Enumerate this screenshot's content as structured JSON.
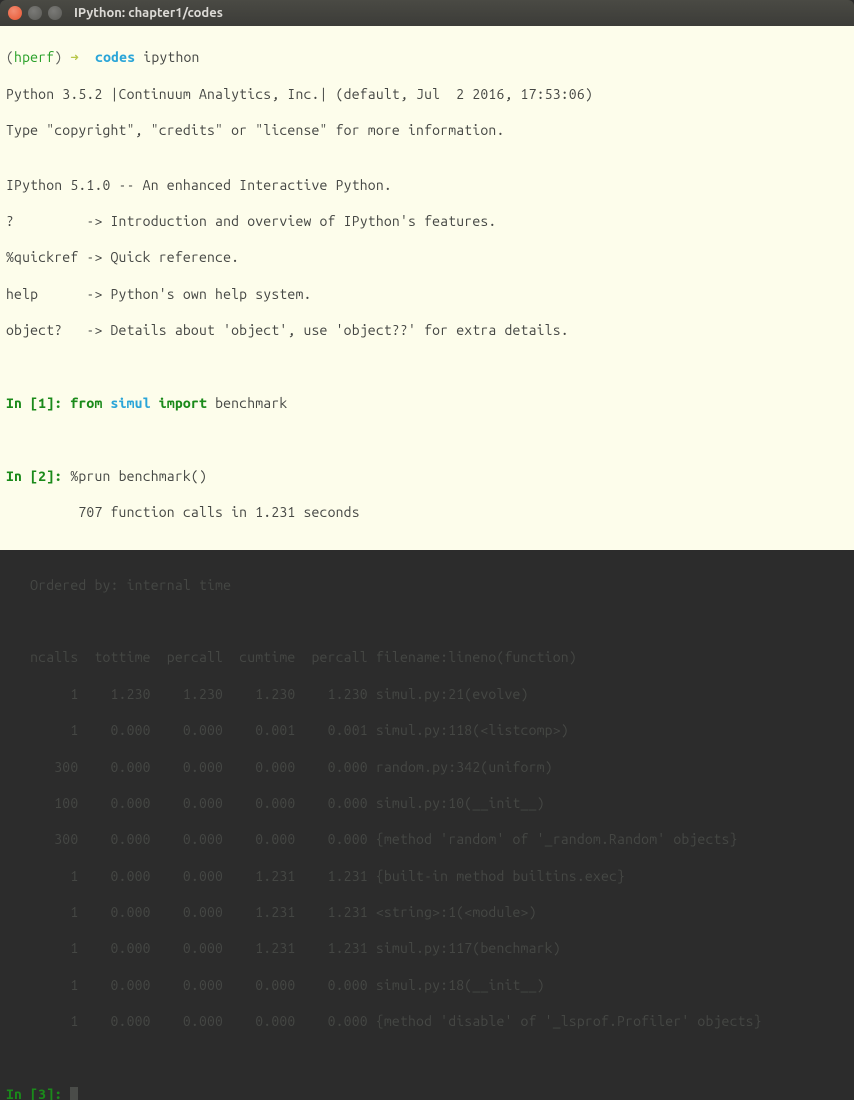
{
  "window": {
    "title": "IPython: chapter1/codes"
  },
  "prompt": {
    "venv_open": "(",
    "venv": "hperf",
    "venv_close": ")",
    "arrow": " ➜ ",
    "dir": " codes",
    "cmd": " ipython"
  },
  "banner": {
    "l1": "Python 3.5.2 |Continuum Analytics, Inc.| (default, Jul  2 2016, 17:53:06)",
    "l2": "Type \"copyright\", \"credits\" or \"license\" for more information.",
    "l3": "",
    "l4": "IPython 5.1.0 -- An enhanced Interactive Python.",
    "l5": "?         -> Introduction and overview of IPython's features.",
    "l6": "%quickref -> Quick reference.",
    "l7": "help      -> Python's own help system.",
    "l8": "object?   -> Details about 'object', use 'object??' for extra details."
  },
  "in1": {
    "label": "In [1]: ",
    "kw_from": "from ",
    "mod": "simul",
    "kw_import": " import ",
    "fn": "benchmark"
  },
  "in2": {
    "label": "In [2]: ",
    "cmd": "%prun benchmark()",
    "summary": "         707 function calls in 1.231 seconds",
    "ordered": "   Ordered by: internal time",
    "header": "   ncalls  tottime  percall  cumtime  percall filename:lineno(function)",
    "rows": [
      "        1    1.230    1.230    1.230    1.230 simul.py:21(evolve)",
      "        1    0.000    0.000    0.001    0.001 simul.py:118(<listcomp>)",
      "      300    0.000    0.000    0.000    0.000 random.py:342(uniform)",
      "      100    0.000    0.000    0.000    0.000 simul.py:10(__init__)",
      "      300    0.000    0.000    0.000    0.000 {method 'random' of '_random.Random' objects}",
      "        1    0.000    0.000    1.231    1.231 {built-in method builtins.exec}",
      "        1    0.000    0.000    1.231    1.231 <string>:1(<module>)",
      "        1    0.000    0.000    1.231    1.231 simul.py:117(benchmark)",
      "        1    0.000    0.000    0.000    0.000 simul.py:18(__init__)",
      "        1    0.000    0.000    0.000    0.000 {method 'disable' of '_lsprof.Profiler' objects}"
    ]
  },
  "in3": {
    "label": "In [3]: "
  },
  "chart_data": {
    "type": "table",
    "title": "%prun benchmark() — 707 function calls in 1.231 seconds (Ordered by: internal time)",
    "columns": [
      "ncalls",
      "tottime",
      "percall",
      "cumtime",
      "percall",
      "filename:lineno(function)"
    ],
    "rows": [
      [
        1,
        1.23,
        1.23,
        1.23,
        1.23,
        "simul.py:21(evolve)"
      ],
      [
        1,
        0.0,
        0.0,
        0.001,
        0.001,
        "simul.py:118(<listcomp>)"
      ],
      [
        300,
        0.0,
        0.0,
        0.0,
        0.0,
        "random.py:342(uniform)"
      ],
      [
        100,
        0.0,
        0.0,
        0.0,
        0.0,
        "simul.py:10(__init__)"
      ],
      [
        300,
        0.0,
        0.0,
        0.0,
        0.0,
        "{method 'random' of '_random.Random' objects}"
      ],
      [
        1,
        0.0,
        0.0,
        1.231,
        1.231,
        "{built-in method builtins.exec}"
      ],
      [
        1,
        0.0,
        0.0,
        1.231,
        1.231,
        "<string>:1(<module>)"
      ],
      [
        1,
        0.0,
        0.0,
        1.231,
        1.231,
        "simul.py:117(benchmark)"
      ],
      [
        1,
        0.0,
        0.0,
        0.0,
        0.0,
        "simul.py:18(__init__)"
      ],
      [
        1,
        0.0,
        0.0,
        0.0,
        0.0,
        "{method 'disable' of '_lsprof.Profiler' objects}"
      ]
    ]
  }
}
